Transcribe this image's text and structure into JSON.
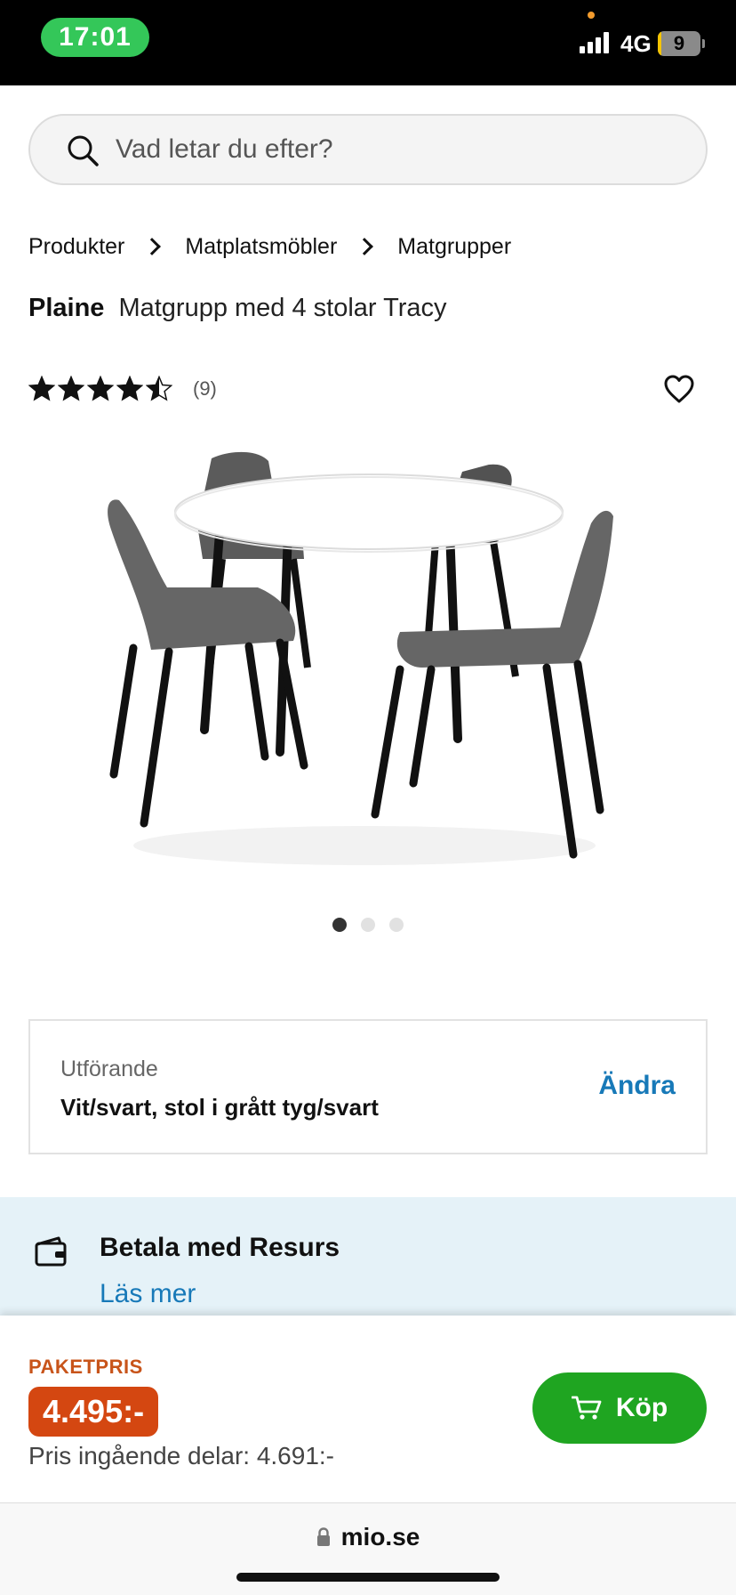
{
  "status_bar": {
    "time": "17:01",
    "network": "4G",
    "battery": "9",
    "battery_level": 0.09
  },
  "search": {
    "placeholder": "Vad letar du efter?",
    "icon": "search-icon"
  },
  "breadcrumb": {
    "items": [
      "Produkter",
      "Matplatsmöbler",
      "Matgrupper"
    ]
  },
  "product": {
    "brand": "Plaine",
    "name": "Matgrupp med 4 stolar Tracy",
    "rating": 4.5,
    "rating_max": 5,
    "rating_count": "(9)",
    "image_index": 1,
    "image_count": 3
  },
  "variant": {
    "label": "Utförande",
    "value": "Vit/svart, stol i grått tyg/svart",
    "change_label": "Ändra"
  },
  "resurs": {
    "title": "Betala med Resurs",
    "link": "Läs mer"
  },
  "price": {
    "label": "PAKETPRIS",
    "value": "4.495:-",
    "parts": "Pris ingående delar: 4.691:-",
    "buy_label": "Köp"
  },
  "browser": {
    "url": "mio.se"
  },
  "colors": {
    "accent_blue": "#1779b8",
    "price_orange": "#d44711",
    "buy_green": "#1fa521",
    "status_green": "#34c759",
    "resurs_bg": "#e5f2f8"
  }
}
